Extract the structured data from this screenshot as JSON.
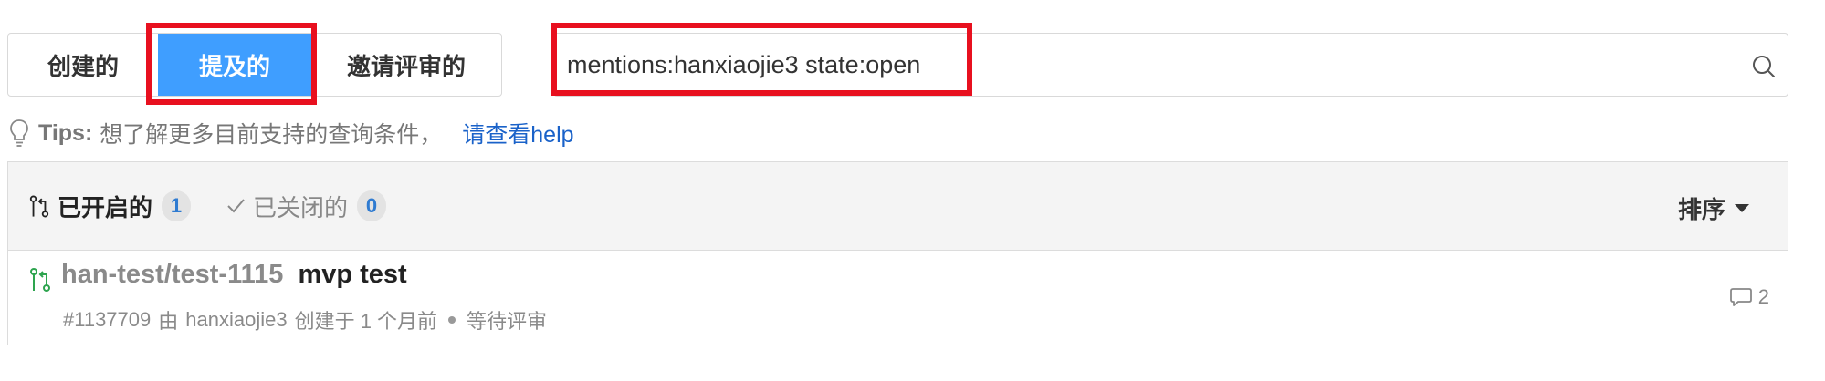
{
  "tabs": [
    {
      "label": "创建的"
    },
    {
      "label": "提及的",
      "active": true
    },
    {
      "label": "邀请评审的"
    }
  ],
  "search": {
    "value": "mentions:hanxiaojie3 state:open"
  },
  "tips": {
    "label": "Tips:",
    "text": "想了解更多目前支持的查询条件，",
    "link": "请查看help"
  },
  "filters": {
    "open": {
      "label": "已开启的",
      "count": "1"
    },
    "closed": {
      "label": "已关闭的",
      "count": "0"
    },
    "sort_label": "排序"
  },
  "pull_requests": [
    {
      "repo": "han-test/test-1115",
      "title": "mvp test",
      "number": "#1137709",
      "by": "由",
      "author": "hanxiaojie3",
      "created": "创建于 1 个月前",
      "status": "等待评审",
      "comments": "2"
    }
  ],
  "colors": {
    "accent": "#3f9eff",
    "highlight": "#e8101f",
    "link": "#1a62c9",
    "pr_open": "#2ea44f"
  },
  "icons": {
    "search": "search-icon",
    "tips": "lightbulb-icon",
    "pr": "pull-request-icon",
    "check": "check-icon",
    "comment": "comment-icon"
  }
}
